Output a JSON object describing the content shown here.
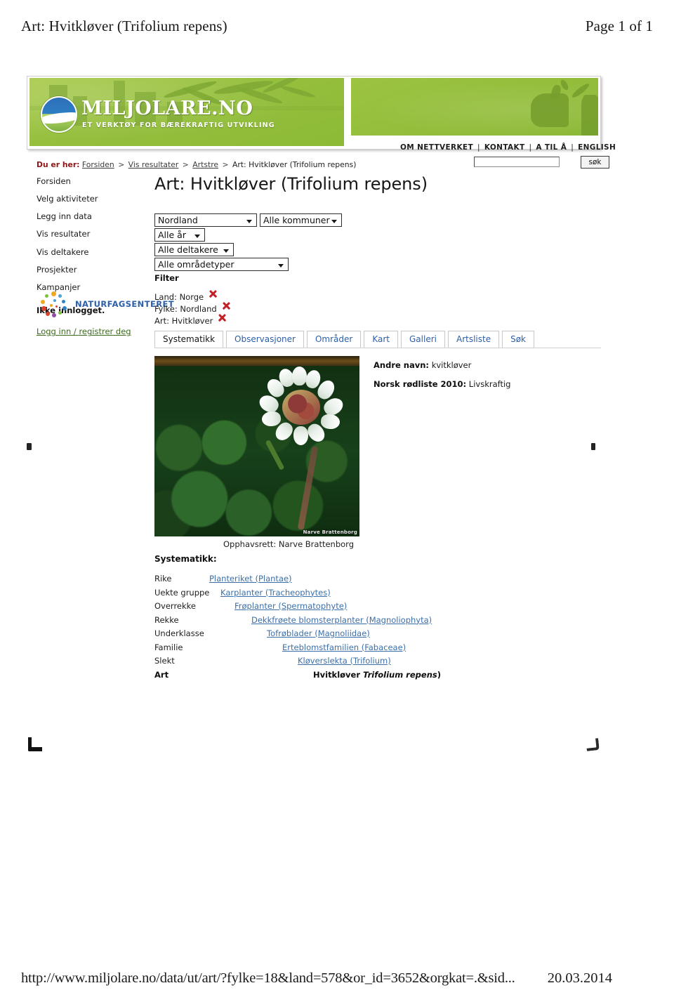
{
  "print": {
    "header_title": "Art: Hvitkløver (Trifolium repens)",
    "header_page": "Page 1 of 1",
    "footer_url": "http://www.miljolare.no/data/ut/art/?fylke=18&land=578&or_id=3652&orgkat=.&sid...",
    "footer_date": "20.03.2014"
  },
  "banner": {
    "logo_title": "MILJOLARE.NO",
    "logo_tagline": "ET VERKTØY FOR BÆREKRAFTIG UTVIKLING"
  },
  "topnav": {
    "items": [
      "OM NETTVERKET",
      "KONTAKT",
      "A TIL Å",
      "ENGLISH"
    ],
    "separator": "|"
  },
  "search": {
    "value": "",
    "placeholder": "",
    "button_label": "søk"
  },
  "breadcrumb": {
    "label": "Du er her:",
    "items": [
      "Forsiden",
      "Vis resultater",
      "Artstre"
    ],
    "current": "Art: Hvitkløver (Trifolium repens)",
    "separator": ">"
  },
  "sidebar": {
    "items": [
      {
        "label": "Forsiden"
      },
      {
        "label": "Velg aktiviteter"
      },
      {
        "label": "Legg inn data"
      },
      {
        "label": "Vis resultater"
      },
      {
        "label": "Vis deltakere"
      },
      {
        "label": "Prosjekter"
      },
      {
        "label": "Kampanjer"
      }
    ],
    "status": "Ikke innlogget.",
    "login_link": "Logg inn / registrer deg",
    "partner_logo_text": "NATURFAGSENTERET"
  },
  "main": {
    "title": "Art: Hvitkløver (Trifolium repens)",
    "selects": [
      {
        "name": "fylke",
        "value": "Nordland"
      },
      {
        "name": "kommune",
        "value": "Alle kommuner"
      },
      {
        "name": "ar",
        "value": "Alle år"
      },
      {
        "name": "deltakere",
        "value": "Alle deltakere"
      },
      {
        "name": "omradetyper",
        "value": "Alle områdetyper"
      }
    ],
    "filter_heading": "Filter",
    "filters": [
      {
        "label": "Land: Norge"
      },
      {
        "label": "Fylke: Nordland"
      },
      {
        "label": "Art: Hvitkløver"
      }
    ],
    "tabs": [
      {
        "label": "Systematikk",
        "active": true
      },
      {
        "label": "Observasjoner",
        "active": false
      },
      {
        "label": "Områder",
        "active": false
      },
      {
        "label": "Kart",
        "active": false
      },
      {
        "label": "Galleri",
        "active": false
      },
      {
        "label": "Artsliste",
        "active": false
      },
      {
        "label": "Søk",
        "active": false
      }
    ],
    "photo": {
      "watermark": "Narve Brattenborg",
      "copyright": "Opphavsrett: Narve Brattenborg"
    },
    "info": [
      {
        "label": "Andre navn:",
        "value": "kvitkløver"
      },
      {
        "label": "Norsk rødliste 2010:",
        "value": "Livskraftig"
      }
    ],
    "systematikk_heading": "Systematikk:",
    "taxonomy": [
      {
        "rank": "Rike",
        "value": "Planteriket (Plantae)",
        "link": true,
        "indent": 0
      },
      {
        "rank": "Uekte gruppe",
        "value": "Karplanter (Tracheophytes)",
        "link": true,
        "indent": 16
      },
      {
        "rank": "Overrekke",
        "value": "Frøplanter (Spermatophyte)",
        "link": true,
        "indent": 36
      },
      {
        "rank": "Rekke",
        "value": "Dekkfrøete blomsterplanter (Magnoliophyta)",
        "link": true,
        "indent": 60
      },
      {
        "rank": "Underklasse",
        "value": "Tofrøblader (Magnoliidae)",
        "link": true,
        "indent": 82
      },
      {
        "rank": "Familie",
        "value": "Erteblomstfamilien (Fabaceae)",
        "link": true,
        "indent": 104
      },
      {
        "rank": "Slekt",
        "value": "Kløverslekta (Trifolium)",
        "link": true,
        "indent": 126
      },
      {
        "rank": "Art",
        "value": "Hvitkløver (Trifolium repens)",
        "link": false,
        "indent": 148
      }
    ]
  },
  "colors": {
    "banner_green": "#95bf3d",
    "link_blue": "#3c6fa8",
    "breadcrumb_red": "#8e1616",
    "delete_red": "#c32026",
    "login_green": "#3d6b1e",
    "partner_blue": "#2d5fa8"
  }
}
